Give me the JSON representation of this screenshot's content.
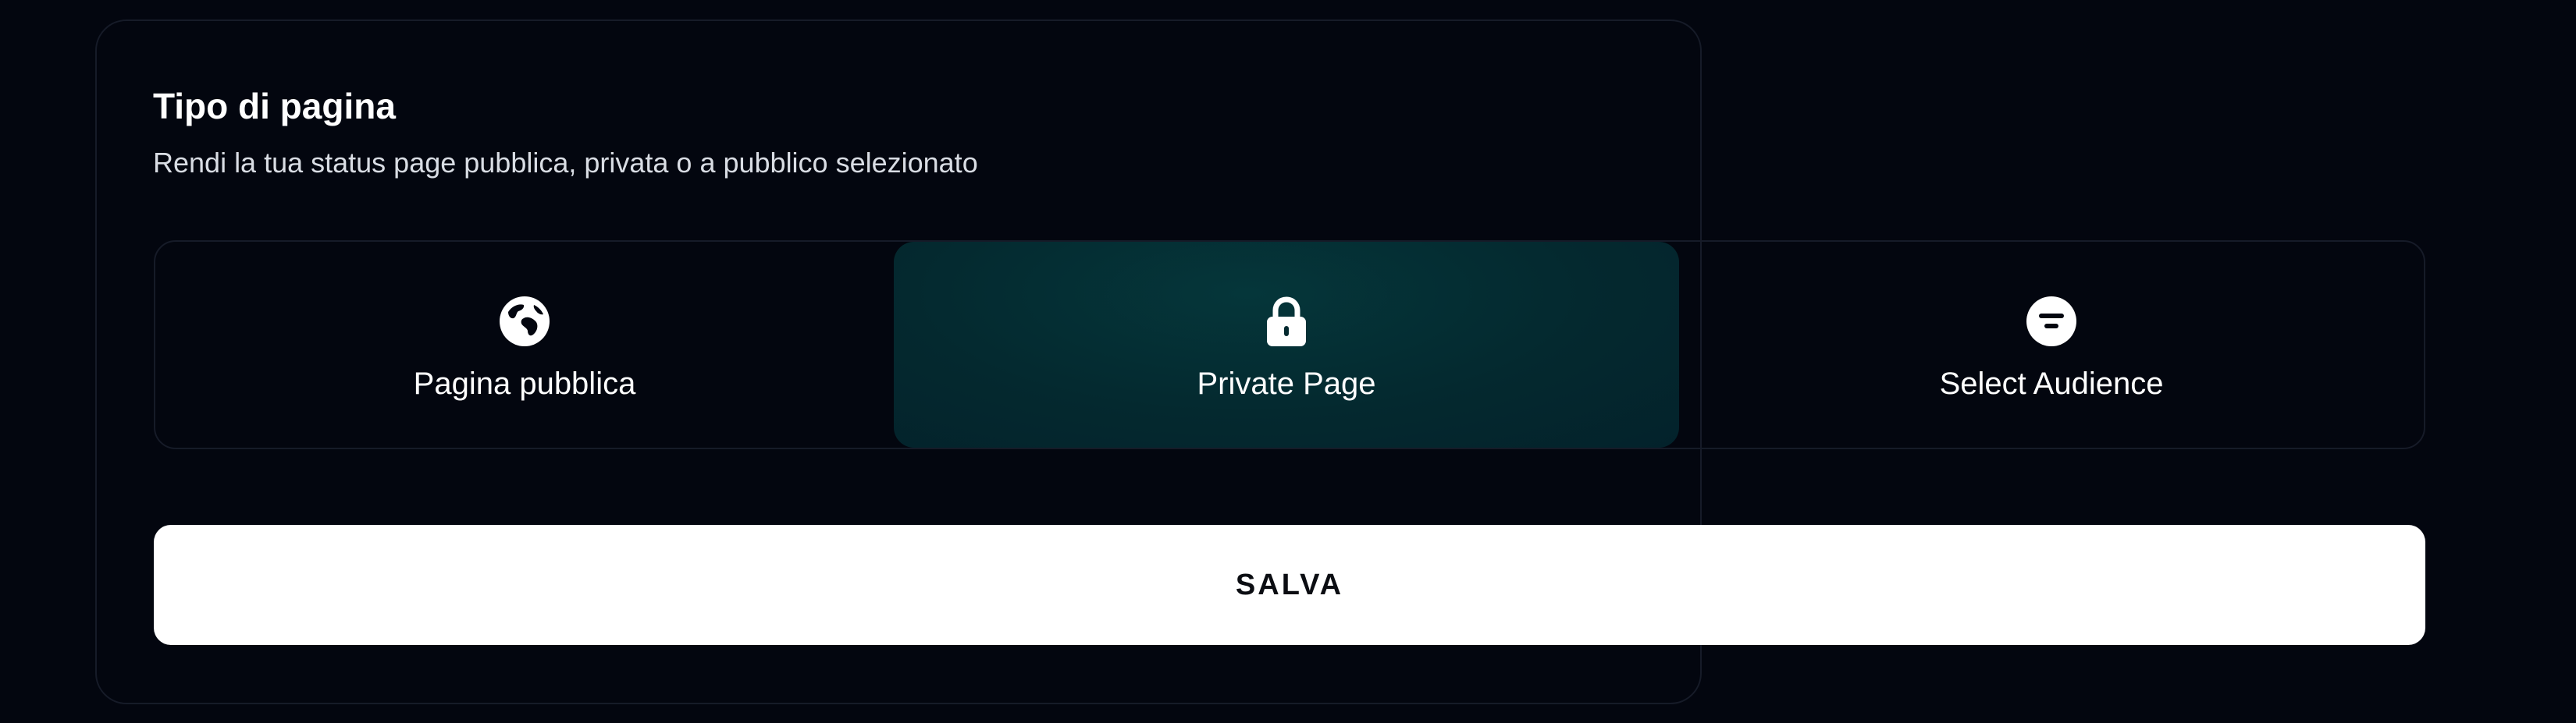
{
  "section": {
    "title": "Tipo di pagina",
    "subtitle": "Rendi la tua status page pubblica, privata o a pubblico selezionato"
  },
  "page_type": {
    "selected": "private",
    "options": [
      {
        "id": "public",
        "label": "Pagina pubblica",
        "icon": "globe-icon"
      },
      {
        "id": "private",
        "label": "Private Page",
        "icon": "lock-icon"
      },
      {
        "id": "audience",
        "label": "Select Audience",
        "icon": "filter-icon"
      }
    ]
  },
  "actions": {
    "save_label": "SALVA"
  },
  "colors": {
    "background": "#03060f",
    "selected_option": "#04292f",
    "border": "#161b28",
    "button": "#ffffff"
  }
}
